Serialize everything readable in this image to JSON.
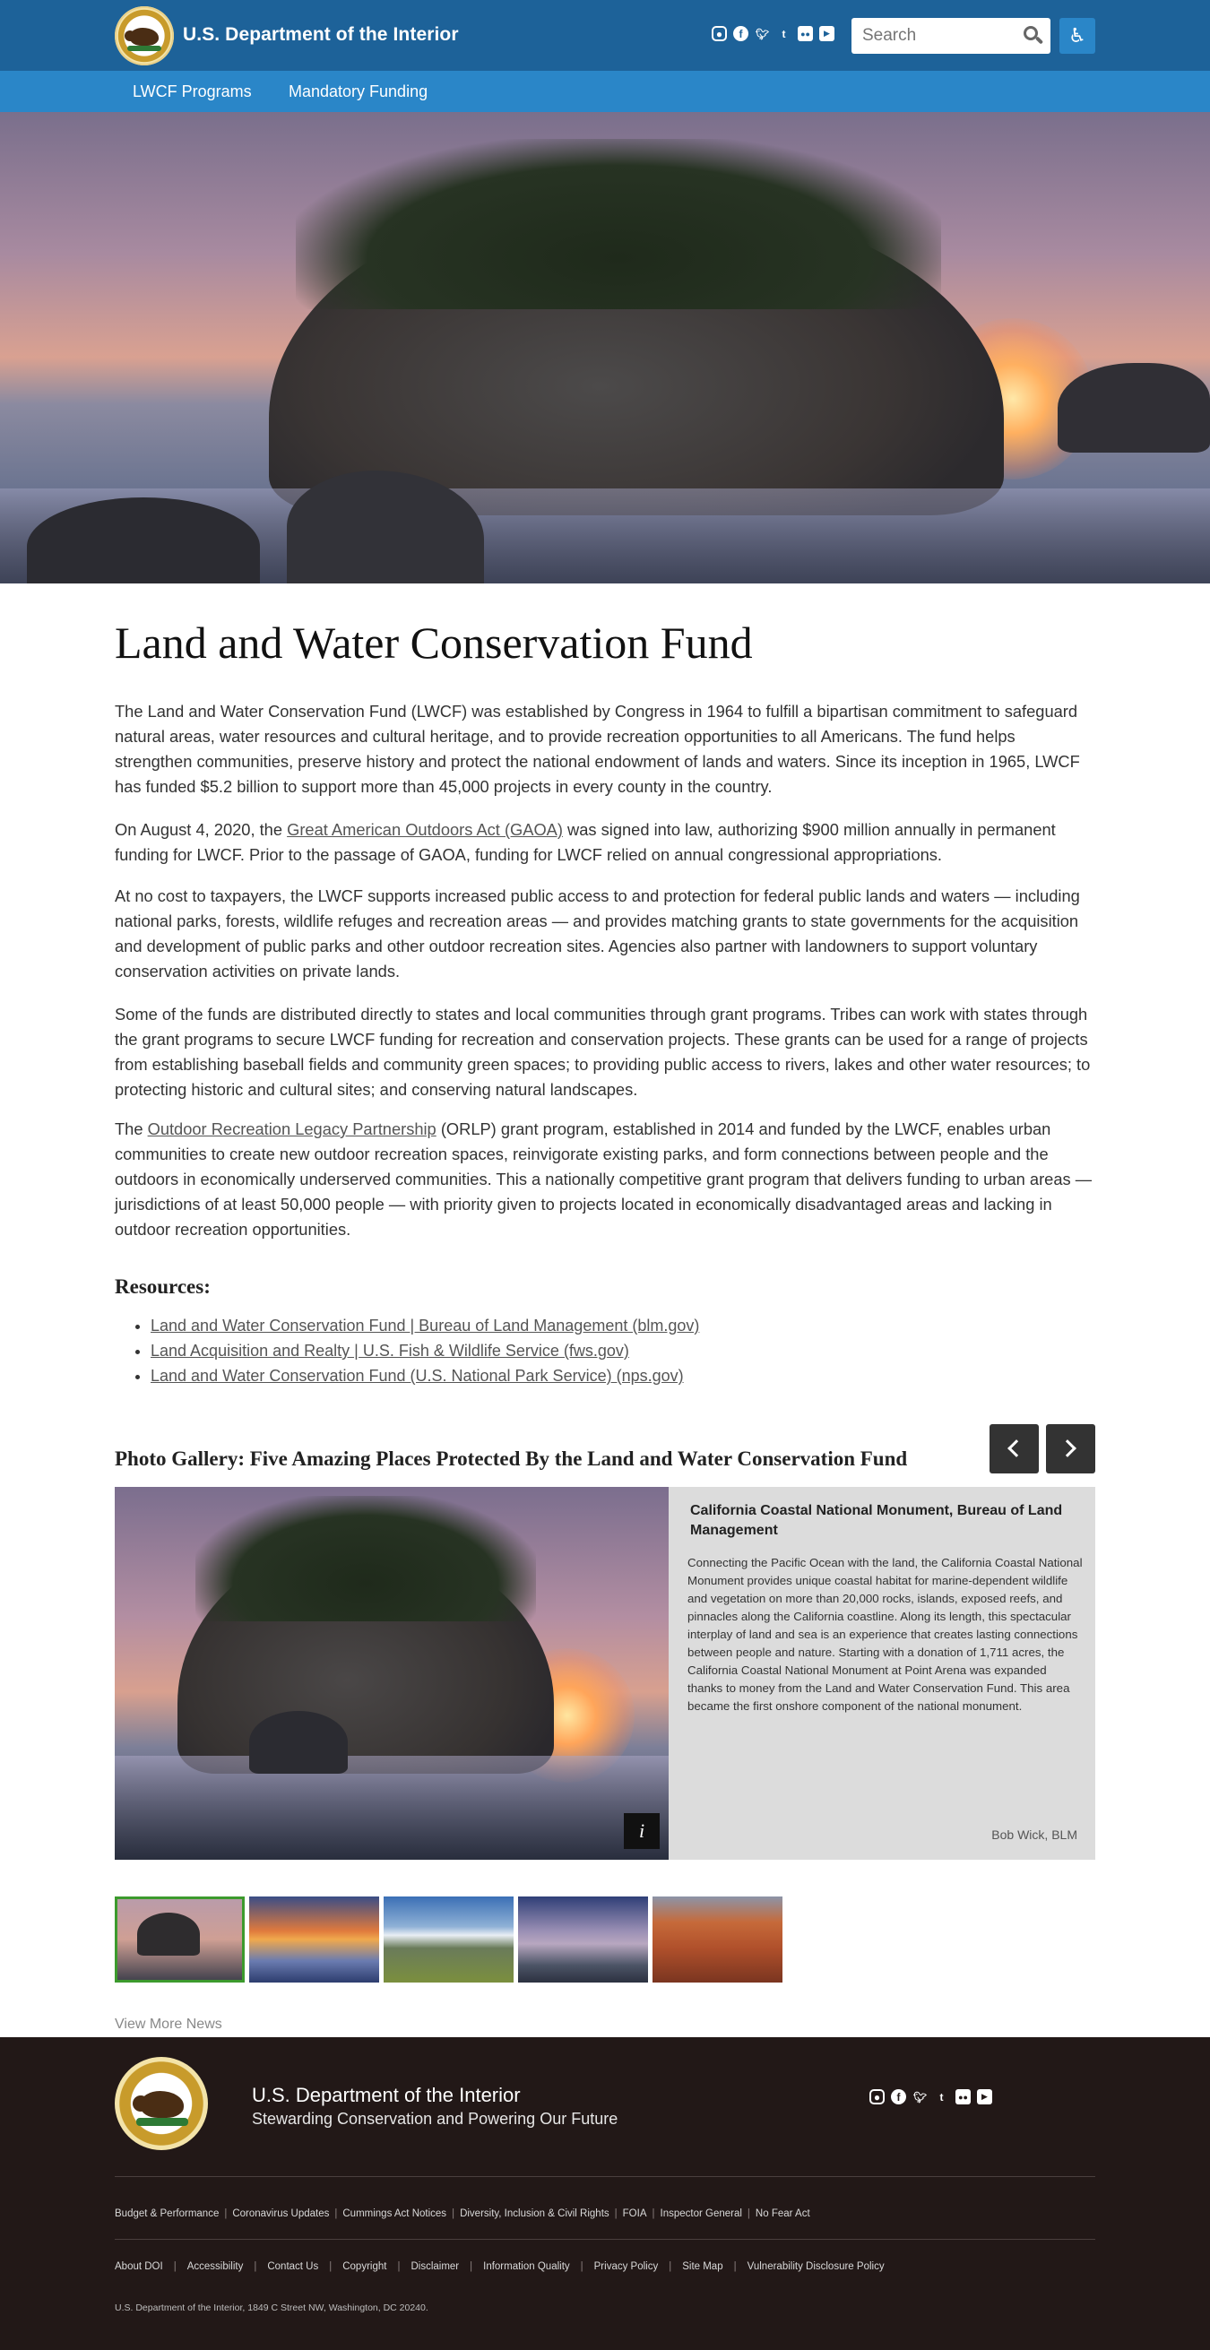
{
  "header": {
    "site_title": "U.S. Department of the Interior",
    "search_placeholder": "Search",
    "social_icons": [
      "instagram-icon",
      "facebook-icon",
      "twitter-icon",
      "tumblr-icon",
      "flickr-icon",
      "youtube-icon"
    ],
    "accessibility_icon": "accessibility-icon",
    "colors": {
      "header_bg": "#1d6299",
      "nav_bg": "#2a86c8"
    }
  },
  "nav": {
    "items": [
      {
        "label": "LWCF Programs"
      },
      {
        "label": "Mandatory Funding"
      }
    ]
  },
  "page": {
    "title": "Land and Water Conservation Fund",
    "p1": "The Land and Water Conservation Fund (LWCF) was established by Congress in 1964 to fulfill a bipartisan commitment to safeguard natural areas, water resources and cultural heritage, and to provide recreation opportunities to all Americans. The fund helps strengthen communities, preserve history and protect the national endowment of lands and waters. Since its inception in 1965, LWCF has funded $5.2 billion to support more than 45,000 projects in every county in the country.",
    "p2_before": "On August 4, 2020, the ",
    "p2_link": "Great American Outdoors Act (GAOA)",
    "p2_after": " was signed into law, authorizing $900 million annually in permanent funding for LWCF. Prior to the passage of GAOA, funding for LWCF relied on annual congressional appropriations.",
    "p3": "At no cost to taxpayers, the LWCF supports increased public access to and protection for federal public lands and waters — including national parks, forests, wildlife refuges and recreation areas — and provides matching grants to state governments for the acquisition and development of public parks and other outdoor recreation sites. Agencies also partner with landowners to support voluntary conservation activities on private lands.",
    "p4": "Some of the funds are distributed directly to states and local communities through grant programs. Tribes can work with states through the grant programs to secure LWCF funding for recreation and conservation projects. These grants can be used for a range of projects from establishing baseball fields and community green spaces; to providing public access to rivers, lakes and other water resources; to protecting historic and cultural sites; and conserving natural landscapes.",
    "p5_before": "The ",
    "p5_link": "Outdoor Recreation Legacy Partnership",
    "p5_after": " (ORLP) grant program, established in 2014 and funded by the LWCF, enables urban communities to create new outdoor recreation spaces, reinvigorate existing parks, and form connections between people and the outdoors in economically underserved communities. This a nationally competitive grant program that delivers funding to urban areas — jurisdictions of at least 50,000 people — with priority given to projects located in economically disadvantaged areas and lacking in outdoor recreation opportunities."
  },
  "resources": {
    "title": "Resources:",
    "links": [
      {
        "label": "Land and Water Conservation Fund | Bureau of Land Management (blm.gov)"
      },
      {
        "label": "Land Acquisition and Realty | U.S. Fish & Wildlife Service (fws.gov)"
      },
      {
        "label": "Land and Water Conservation Fund (U.S. National Park Service) (nps.gov)"
      }
    ]
  },
  "gallery": {
    "title": "Photo Gallery: Five Amazing Places Protected By the Land and Water Conservation Fund",
    "prev_icon": "chevron-left-icon",
    "next_icon": "chevron-right-icon",
    "info_label": "i",
    "slide": {
      "heading": "California Coastal National Monument, Bureau of Land Management",
      "description": "Connecting the Pacific Ocean with the land, the California Coastal National Monument provides unique coastal habitat for marine-dependent wildlife and vegetation on more than 20,000 rocks, islands, exposed reefs, and pinnacles along the California coastline. Along its length, this spectacular interplay of land and sea is an experience that creates lasting connections between people and nature. Starting with a donation of 1,711 acres, the California Coastal National Monument at Point Arena was expanded thanks to money from the Land and Water Conservation Fund. This area became the first onshore component of the national monument.",
      "credit": "Bob Wick, BLM"
    },
    "thumbnail_count": 5,
    "active_thumbnail": 1,
    "active_color": "#3c9a2d",
    "view_more": "View More News"
  },
  "footer": {
    "title": "U.S. Department of the Interior",
    "tagline": "Stewarding Conservation and Powering Our Future",
    "links_row1": [
      "Budget & Performance",
      "Coronavirus Updates",
      "Cummings Act Notices",
      "Diversity, Inclusion & Civil Rights",
      "FOIA",
      "Inspector General",
      "No Fear Act"
    ],
    "links_row2": [
      "About DOI",
      "Accessibility",
      "Contact Us",
      "Copyright",
      "Disclaimer",
      "Information Quality",
      "Privacy Policy",
      "Site Map",
      "Vulnerability Disclosure Policy"
    ],
    "address": "U.S. Department of the Interior, 1849 C Street NW, Washington, DC 20240.",
    "colors": {
      "footer_bg": "#221817"
    }
  }
}
